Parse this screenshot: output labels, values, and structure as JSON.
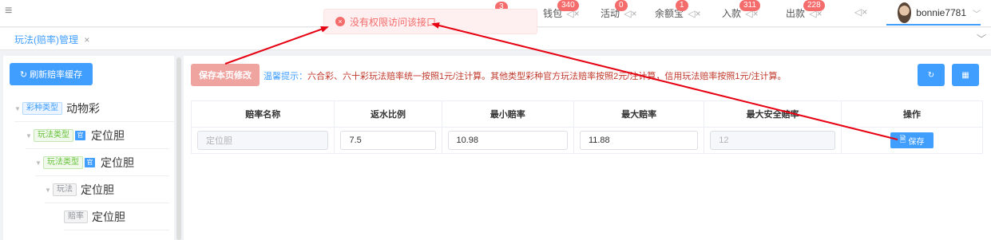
{
  "topbar": {
    "menu_icon": "menu-icon",
    "nav": [
      {
        "label": "钱包",
        "badge": "340",
        "mute": "◁×"
      },
      {
        "label": "活动",
        "badge": "0",
        "mute": "◁×"
      },
      {
        "label": "余额宝",
        "badge": "1",
        "mute": "◁×"
      },
      {
        "label": "入款",
        "badge": "311",
        "mute": "◁×"
      },
      {
        "label": "出款",
        "badge": "228",
        "mute": "◁×"
      }
    ],
    "extra_mute": "◁×",
    "hidden_badge": "3",
    "user": {
      "name": "bonnie7781",
      "caret": "﹀"
    }
  },
  "tabs": {
    "active": {
      "label": "玩法(赔率)管理",
      "close": "×"
    },
    "dropdown": "﹀"
  },
  "left": {
    "refresh_label": "刷新赔率缓存",
    "refresh_icon": "↻",
    "tree": [
      {
        "tag": "彩种类型",
        "tag_color": "blue",
        "icon": "",
        "label": "动物彩"
      },
      {
        "tag": "玩法类型",
        "tag_color": "green",
        "icon": "官",
        "label": "定位胆"
      },
      {
        "tag": "玩法类型",
        "tag_color": "green",
        "icon": "官",
        "label": "定位胆"
      },
      {
        "tag": "玩法",
        "tag_color": "gray",
        "icon": "",
        "label": "定位胆"
      },
      {
        "tag": "赔率",
        "tag_color": "gray",
        "icon": "",
        "label": "定位胆"
      }
    ]
  },
  "main": {
    "save_page_label": "保存本页修改",
    "tip_label": "温馨提示：",
    "tip_text": "六合彩、六十彩玩法赔率统一按照1元/注计算。其他类型彩种官方玩法赔率按照2元/注计算，信用玩法赔率按照1元/注计算。",
    "refresh_icon": "↻",
    "grid_icon": "▦",
    "columns": [
      "赔率名称",
      "返水比例",
      "最小赔率",
      "最大赔率",
      "最大安全赔率",
      "操作"
    ],
    "row": {
      "name": "定位胆",
      "rebate": "7.5",
      "min_odds": "10.98",
      "max_odds": "11.88",
      "max_safe_odds": "12",
      "save_label": "保存",
      "save_icon": "🗎"
    }
  },
  "toast": {
    "message": "没有权限访问该接口",
    "icon": "×"
  },
  "colors": {
    "primary": "#409eff",
    "danger": "#f56c6c",
    "annotation": "#e60012"
  }
}
